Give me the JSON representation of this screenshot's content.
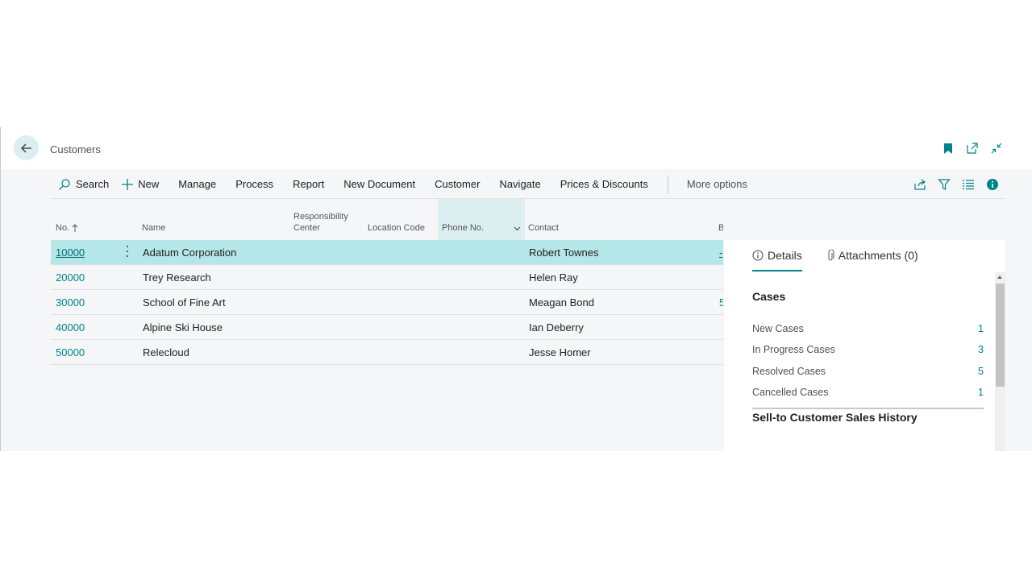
{
  "page": {
    "title": "Customers"
  },
  "actions": [
    {
      "label": "Search",
      "icon": "search-icon"
    },
    {
      "label": "New",
      "icon": "plus-icon"
    },
    {
      "label": "Manage"
    },
    {
      "label": "Process"
    },
    {
      "label": "Report"
    },
    {
      "label": "New Document"
    },
    {
      "label": "Customer"
    },
    {
      "label": "Navigate"
    },
    {
      "label": "Prices & Discounts"
    }
  ],
  "more_options": "More options",
  "columns": {
    "no": "No.",
    "name": "Name",
    "responsibility_center_1": "Responsibility",
    "responsibility_center_2": "Center",
    "location_code": "Location Code",
    "phone_no": "Phone No.",
    "contact": "Contact",
    "b": "B"
  },
  "customers": [
    {
      "no": "10000",
      "name": "Adatum Corporation",
      "contact": "Robert Townes",
      "b": "-"
    },
    {
      "no": "20000",
      "name": "Trey Research",
      "contact": "Helen Ray",
      "b": ""
    },
    {
      "no": "30000",
      "name": "School of Fine Art",
      "contact": "Meagan Bond",
      "b": "5"
    },
    {
      "no": "40000",
      "name": "Alpine Ski House",
      "contact": "Ian Deberry",
      "b": ""
    },
    {
      "no": "50000",
      "name": "Relecloud",
      "contact": "Jesse Homer",
      "b": ""
    }
  ],
  "factbox": {
    "tabs": {
      "details": "Details",
      "attachments": "Attachments (0)"
    },
    "cases_title": "Cases",
    "cases": [
      {
        "label": "New Cases",
        "value": "1"
      },
      {
        "label": "In Progress Cases",
        "value": "3"
      },
      {
        "label": "Resolved Cases",
        "value": "5"
      },
      {
        "label": "Cancelled Cases",
        "value": "1"
      }
    ],
    "sales_history_title": "Sell-to Customer Sales History"
  },
  "colors": {
    "accent": "#00838b",
    "selected_row": "#b5e6e8",
    "active_column": "#dceff0"
  }
}
